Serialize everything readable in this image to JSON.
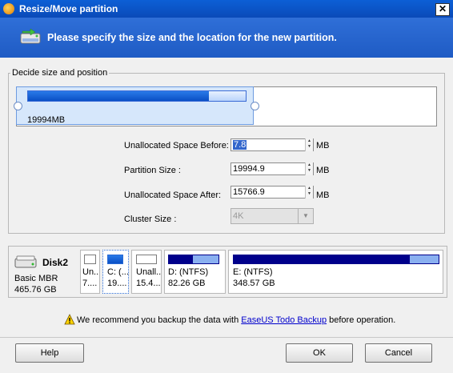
{
  "window": {
    "title": "Resize/Move partition",
    "close_glyph": "✕"
  },
  "header": {
    "text": "Please specify the size and the location for the new partition."
  },
  "group": {
    "label": "Decide size and position"
  },
  "partition_bar": {
    "size_label": "19994MB",
    "fill_fraction": 0.83
  },
  "form": {
    "before": {
      "label": "Unallocated Space Before:",
      "value": "7.8",
      "unit": "MB"
    },
    "size": {
      "label": "Partition Size :",
      "value": "19994.9",
      "unit": "MB"
    },
    "after": {
      "label": "Unallocated Space After:",
      "value": "15766.9",
      "unit": "MB"
    },
    "cluster": {
      "label": "Cluster Size :",
      "value": "4K"
    }
  },
  "disk": {
    "name": "Disk2",
    "type": "Basic MBR",
    "size": "465.76 GB",
    "partitions": [
      {
        "line1": "Un..",
        "line2": "7...."
      },
      {
        "line1": "C: (...",
        "line2": "19...."
      },
      {
        "line1": "Unall...",
        "line2": "15.4..."
      },
      {
        "line1": "D: (NTFS)",
        "line2": "82.26 GB"
      },
      {
        "line1": "E: (NTFS)",
        "line2": "348.57 GB"
      }
    ]
  },
  "recommend": {
    "prefix": "We recommend you backup the data with ",
    "link": "EaseUS Todo Backup",
    "suffix": " before operation."
  },
  "buttons": {
    "help": "Help",
    "ok": "OK",
    "cancel": "Cancel"
  },
  "colors": {
    "title_bar": "#0a4ab8",
    "header": "#2563cc",
    "partition_fill": "#0a4fc5",
    "disk_fill": "#00008b"
  },
  "icons": [
    "app-icon",
    "close-icon",
    "partition-resize-icon",
    "hard-disk-icon",
    "warning-icon",
    "spin-up-icon",
    "spin-down-icon",
    "dropdown-icon"
  ]
}
